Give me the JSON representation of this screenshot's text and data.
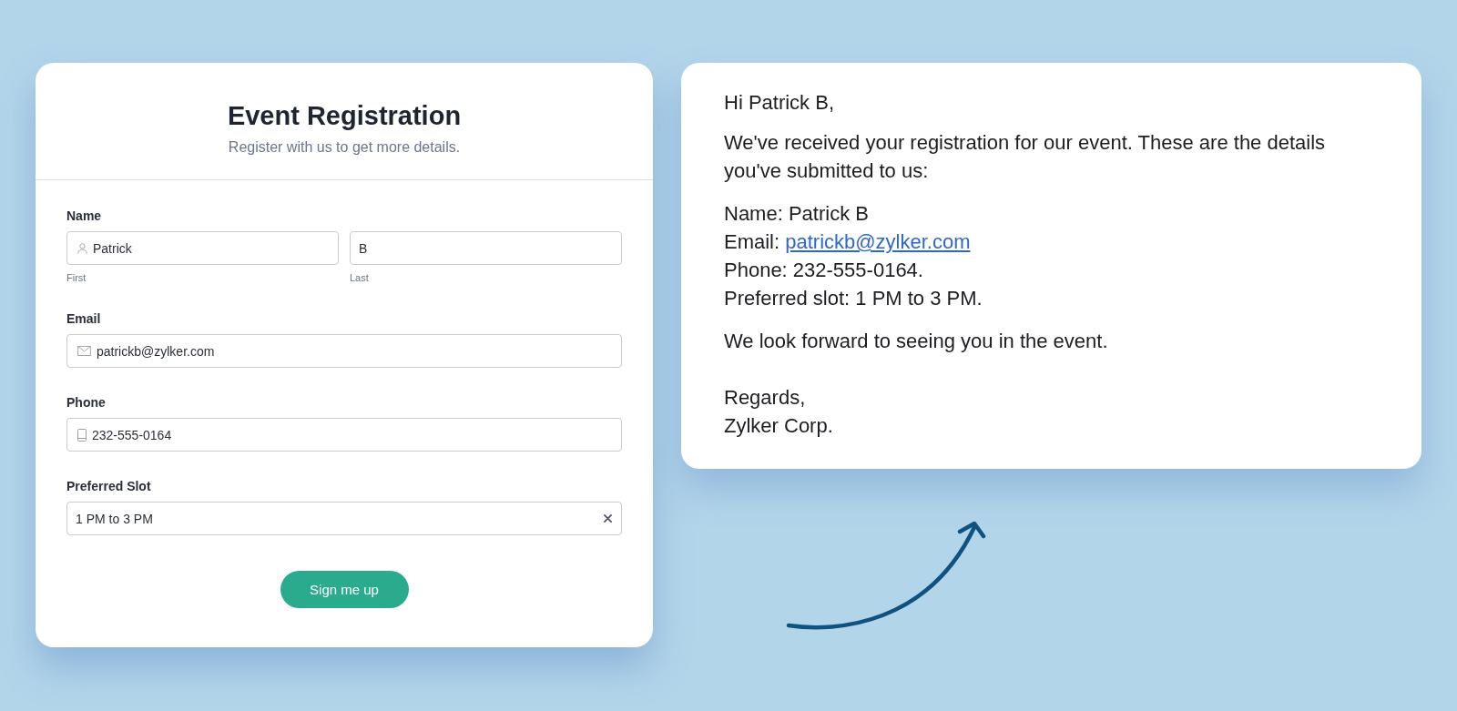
{
  "form": {
    "title": "Event Registration",
    "subtitle": "Register with us to get more details.",
    "fields": [
      {
        "kind": "name",
        "label": "Name",
        "inputs": [
          {
            "value": "Patrick",
            "sublabel": "First"
          },
          {
            "value": "B",
            "sublabel": "Last"
          }
        ]
      },
      {
        "kind": "email",
        "label": "Email",
        "inputs": [
          {
            "value": "patrickb@zylker.com"
          }
        ]
      },
      {
        "kind": "phone",
        "label": "Phone",
        "inputs": [
          {
            "value": "232-555-0164"
          }
        ]
      },
      {
        "kind": "select",
        "label": "Preferred Slot",
        "inputs": [
          {
            "value": "1 PM to 3 PM"
          }
        ]
      }
    ],
    "submit": "Sign me up"
  },
  "email": {
    "greeting": "Hi Patrick B,",
    "intro": "We've received your registration for our event. These are the details you've submitted to us:",
    "details": [
      {
        "kind": "text",
        "label": "Name:",
        "value": "Patrick B"
      },
      {
        "kind": "link",
        "label": "Email:",
        "value": "patrickb@zylker.com"
      },
      {
        "kind": "text",
        "label": "Phone:",
        "value": "232-555-0164."
      },
      {
        "kind": "text",
        "label": "Preferred slot:",
        "value": "1 PM to 3 PM."
      }
    ],
    "closing": "We look forward to seeing you in the event.",
    "signoff": [
      "Regards,",
      "Zylker Corp."
    ]
  }
}
